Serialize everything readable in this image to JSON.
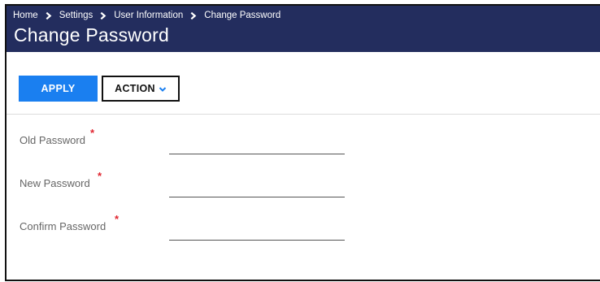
{
  "breadcrumb": {
    "items": [
      "Home",
      "Settings",
      "User Information",
      "Change Password"
    ]
  },
  "page": {
    "title": "Change Password"
  },
  "toolbar": {
    "apply_label": "APPLY",
    "action_label": "ACTION"
  },
  "form": {
    "required_marker": "*",
    "fields": [
      {
        "label": "Old Password",
        "value": ""
      },
      {
        "label": "New Password",
        "value": ""
      },
      {
        "label": "Confirm Password",
        "value": ""
      }
    ]
  },
  "colors": {
    "header_bg": "#232d5e",
    "apply_bg": "#1a7ff0",
    "required": "#e0242f"
  },
  "icons": [
    "chevron-right-icon",
    "chevron-down-icon"
  ]
}
